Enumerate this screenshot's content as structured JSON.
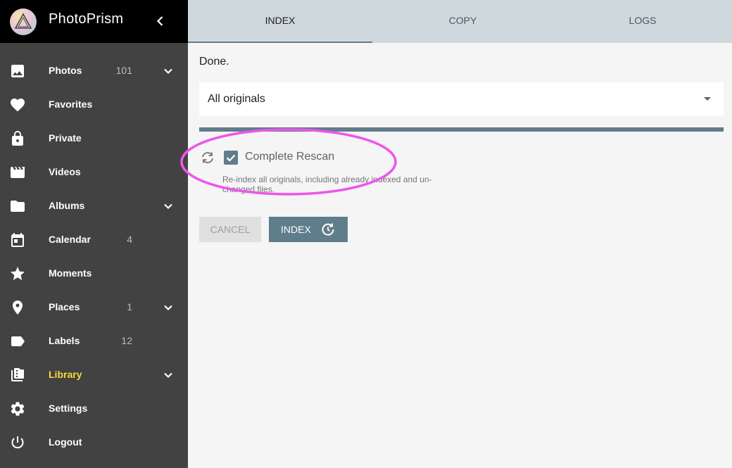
{
  "app": {
    "title": "PhotoPrism"
  },
  "sidebar": {
    "items": [
      {
        "label": "Photos",
        "count": "101",
        "icon": "image-icon",
        "expandable": true
      },
      {
        "label": "Favorites",
        "count": "",
        "icon": "heart-icon",
        "expandable": false
      },
      {
        "label": "Private",
        "count": "",
        "icon": "lock-icon",
        "expandable": false
      },
      {
        "label": "Videos",
        "count": "",
        "icon": "video-icon",
        "expandable": false
      },
      {
        "label": "Albums",
        "count": "",
        "icon": "folder-icon",
        "expandable": true
      },
      {
        "label": "Calendar",
        "count": "4",
        "icon": "calendar-icon",
        "expandable": false
      },
      {
        "label": "Moments",
        "count": "",
        "icon": "star-icon",
        "expandable": false
      },
      {
        "label": "Places",
        "count": "1",
        "icon": "place-icon",
        "expandable": true
      },
      {
        "label": "Labels",
        "count": "12",
        "icon": "label-icon",
        "expandable": false
      },
      {
        "label": "Library",
        "count": "",
        "icon": "library-icon",
        "expandable": true,
        "active": true
      },
      {
        "label": "Settings",
        "count": "",
        "icon": "gear-icon",
        "expandable": false
      },
      {
        "label": "Logout",
        "count": "",
        "icon": "power-icon",
        "expandable": false
      }
    ]
  },
  "tabs": [
    {
      "label": "INDEX",
      "active": true
    },
    {
      "label": "COPY",
      "active": false
    },
    {
      "label": "LOGS",
      "active": false
    }
  ],
  "main": {
    "status": "Done.",
    "select_value": "All originals",
    "progress_fraction": 1.0,
    "checkbox_label": "Complete Rescan",
    "checkbox_checked": true,
    "hint_line1": "Re-index all originals, including already indexed and un-",
    "hint_line2": "changed files.",
    "cancel_label": "Cancel",
    "index_label": "Index"
  },
  "colors": {
    "sidebar_bg": "#424242",
    "header_bg": "#000000",
    "tabs_bg": "#cfd8dc",
    "accent": "#607d8b",
    "active_nav": "#fdd835",
    "highlight": "#ee55ee"
  }
}
